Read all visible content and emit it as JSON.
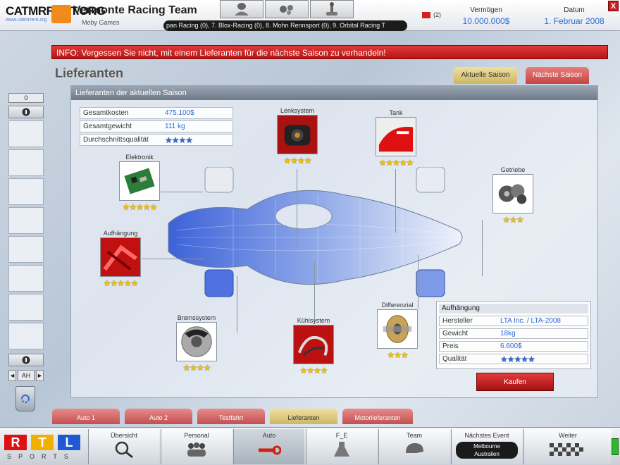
{
  "topbar": {
    "watermark": "CATMRRENT.ORG",
    "watermark_sub": "www.catmrrent.org",
    "team_name": "Vermonte Racing Team",
    "developer": "Moby Games",
    "ticker": "pan Racing (0),   7. Blox-Racing (0),   8. Mohn Rennsport (0),   9. Orbital Racing T",
    "message_count": "(2)",
    "assets_label": "Vermögen",
    "assets_value": "10.000.000$",
    "date_label": "Datum",
    "date_value": "1. Februar 2008",
    "close": "X",
    "icons": [
      "driver-icon",
      "engine-parts-icon",
      "joystick-icon"
    ]
  },
  "sidebar": {
    "counter": "0",
    "pager_label": "AH",
    "prev": "◄",
    "next": "►"
  },
  "info_bar": "INFO: Vergessen Sie nicht, mit einem Lieferanten für die nächste Saison zu verhandeln!",
  "page_title": "Lieferanten",
  "season_tabs": {
    "current": "Aktuelle Saison",
    "next": "Nächste Saison"
  },
  "panel_title": "Lieferanten der aktuellen Saison",
  "summary": [
    {
      "label": "Gesamtkosten",
      "value": "475.100$"
    },
    {
      "label": "Gesamtgewicht",
      "value": "111 kg"
    },
    {
      "label": "Durchschnittsqualität",
      "value": "★★★★"
    }
  ],
  "components": {
    "elektronik": {
      "name": "Elektronik",
      "stars": "★★★★★"
    },
    "lenksystem": {
      "name": "Lenksystem",
      "stars": "★★★★"
    },
    "tank": {
      "name": "Tank",
      "stars": "★★★★★"
    },
    "getriebe": {
      "name": "Getriebe",
      "stars": "★★★"
    },
    "aufhaengung": {
      "name": "Aufhängung",
      "stars": "★★★★★"
    },
    "bremssystem": {
      "name": "Bremssystem",
      "stars": "★★★★"
    },
    "kuehlsystem": {
      "name": "Kühlsystem",
      "stars": "★★★★"
    },
    "differenzial": {
      "name": "Differenzial",
      "stars": "★★★"
    }
  },
  "detail": {
    "title": "Aufhängung",
    "rows": [
      {
        "label": "Hersteller",
        "value": "LTA Inc. / LTA-2008"
      },
      {
        "label": "Gewicht",
        "value": "18kg"
      },
      {
        "label": "Preis",
        "value": "6.600$"
      },
      {
        "label": "Qualität",
        "value": "★★★★★"
      }
    ],
    "buy_label": "Kaufen"
  },
  "bottom_tabs": [
    "Auto 1",
    "Auto 2",
    "Testfahrt",
    "Lieferanten",
    "Motorlieferanten"
  ],
  "rtl": {
    "letters": [
      "R",
      "T",
      "L"
    ],
    "sports": "SPORTS"
  },
  "nav": [
    {
      "label": "Übersicht",
      "icon": "magnifier-icon"
    },
    {
      "label": "Personal",
      "icon": "people-icon"
    },
    {
      "label": "Auto",
      "icon": "wrench-icon"
    },
    {
      "label": "F_E",
      "icon": "flask-icon"
    },
    {
      "label": "Team",
      "icon": "helmet-icon"
    },
    {
      "label": "Nächstes Event",
      "event_line1": "Melbourne",
      "event_line2": "Australien"
    },
    {
      "label": "Weiter",
      "icon": "checkered-flag-icon"
    }
  ],
  "colors": {
    "accent_red": "#c81a1a",
    "value_blue": "#2c6ad8",
    "star_gold": "#f2c200"
  }
}
